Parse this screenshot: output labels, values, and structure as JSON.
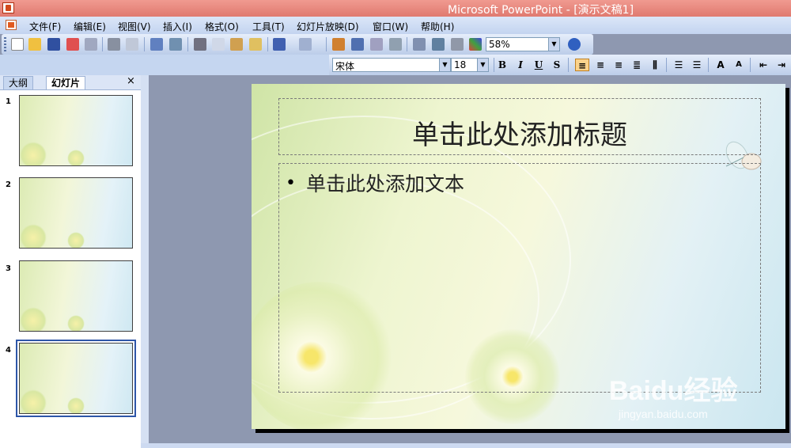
{
  "window": {
    "title": "Microsoft PowerPoint - [演示文稿1]"
  },
  "menu": {
    "items": [
      "文件(F)",
      "编辑(E)",
      "视图(V)",
      "插入(I)",
      "格式(O)",
      "工具(T)",
      "幻灯片放映(D)",
      "窗口(W)",
      "帮助(H)"
    ]
  },
  "toolbar": {
    "zoom": "58%",
    "font": "宋体",
    "font_size": "18",
    "bold": "B",
    "italic": "I",
    "underline": "U",
    "shadow": "S"
  },
  "panel": {
    "tab_outline": "大纲",
    "tab_slides": "幻灯片",
    "close": "×",
    "slide_numbers": [
      "1",
      "2",
      "3",
      "4"
    ],
    "selected_slide": 4
  },
  "slide": {
    "title_placeholder": "单击此处添加标题",
    "body_bullet": "•",
    "body_placeholder": "单击此处添加文本"
  },
  "watermark": {
    "brand": "Baidu经验",
    "url": "jingyan.baidu.com"
  },
  "colors": {
    "titlebar": "#e88070",
    "selection": "#2e56a8",
    "active_button": "#fbd38c"
  }
}
